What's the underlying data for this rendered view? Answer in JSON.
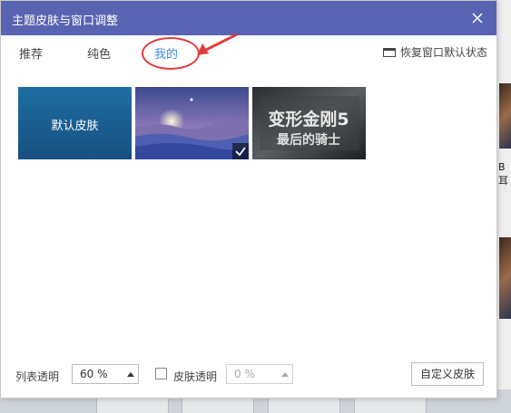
{
  "dialog": {
    "title": "主题皮肤与窗口调整"
  },
  "tabs": [
    {
      "label": "推荐",
      "active": false
    },
    {
      "label": "纯色",
      "active": false
    },
    {
      "label": "我的",
      "active": true
    }
  ],
  "restore_label": "恢复窗口默认状态",
  "skins": [
    {
      "label": "默认皮肤",
      "selected": false
    },
    {
      "label": "",
      "selected": true
    },
    {
      "label": "变形金刚5 最后的骑士",
      "title_line1": "变形金刚5",
      "title_line2": "最后的骑士",
      "selected": false
    }
  ],
  "footer": {
    "list_transparency_label": "列表透明",
    "list_transparency_value": "60 %",
    "skin_transparency_label": "皮肤透明",
    "skin_transparency_value": "0 %",
    "skin_transparency_checked": false,
    "custom_skin_label": "自定义皮肤"
  },
  "background": {
    "partial_text": "B耳"
  },
  "colors": {
    "titlebar": "#5864b2",
    "active_tab": "#3a8ee6",
    "annotation": "#e23b3b"
  }
}
